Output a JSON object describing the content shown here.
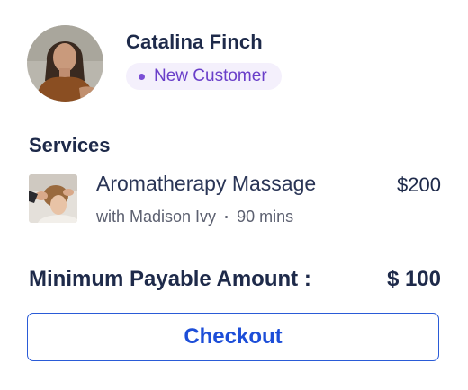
{
  "customer": {
    "name": "Catalina Finch",
    "badge": "New Customer",
    "avatar_icon": "customer-avatar",
    "badge_color": "#6a3fc9",
    "badge_bg": "#f4f0fc"
  },
  "services": {
    "title": "Services",
    "items": [
      {
        "name": "Aromatherapy Massage",
        "therapist": "with Madison Ivy",
        "duration": "90 mins",
        "price": "$200",
        "thumbnail_icon": "massage-thumbnail"
      }
    ]
  },
  "summary": {
    "min_label": "Minimum Payable Amount :",
    "min_amount": "$ 100"
  },
  "checkout": {
    "label": "Checkout",
    "accent": "#1d4ed8"
  }
}
